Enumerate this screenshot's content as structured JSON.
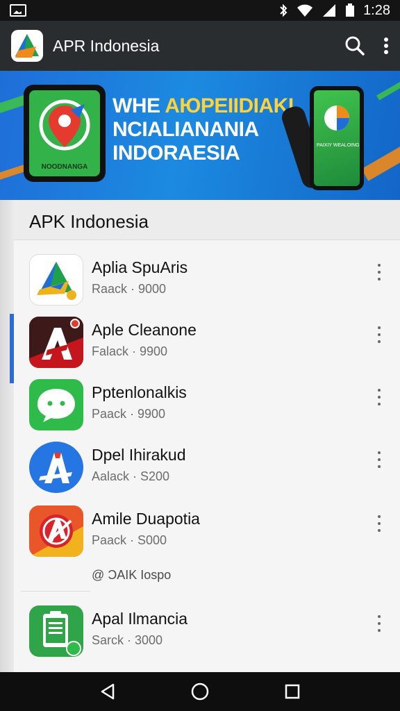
{
  "status_bar": {
    "time": "1:28",
    "icons": [
      "gallery-icon",
      "bluetooth-icon",
      "wifi-icon",
      "signal-icon",
      "battery-icon"
    ]
  },
  "app_bar": {
    "title": "APR Indonesia",
    "icons": [
      "app-logo",
      "search-icon",
      "more-vert-icon"
    ]
  },
  "banner": {
    "line1_white": "WHE ",
    "line1_yellow": "AЮPEIIDIAKI",
    "line2": "NCIALIANANIA",
    "line3": "INDORAESIA",
    "phone_caption": "NOODNANGA",
    "right_phone_caption": "PAIXIY WEALOING"
  },
  "section": {
    "title": "APK Indonesia"
  },
  "apps": [
    {
      "name": "Aplia SpuAris",
      "sub": "Raack · 9000",
      "icon": "triangle-arrow-icon"
    },
    {
      "name": "Aple Cleanone",
      "sub": "Falack · 9900",
      "icon": "red-a-icon"
    },
    {
      "name": "Pptenlonalkis",
      "sub": "Paack · 9900",
      "icon": "chat-bubble-icon"
    },
    {
      "name": "Dpel Ihirakud",
      "sub": "Aalack · S200",
      "icon": "blue-a-icon"
    },
    {
      "name": "Amile Duapotia",
      "sub": "Paack · S000",
      "icon": "orange-a-icon"
    },
    {
      "name": "Apal Ilmancia",
      "sub": "Sarck · 3000",
      "icon": "green-clipboard-icon"
    }
  ],
  "promo": "@ ƆAIK Iospo",
  "nav": [
    "back-icon",
    "home-icon",
    "recents-icon"
  ],
  "colors": {
    "appbar": "#2a2d2f",
    "banner_blue": "#1c8ae0",
    "accent_blue": "#2f6ad6",
    "banner_yellow": "#ffd23a"
  }
}
